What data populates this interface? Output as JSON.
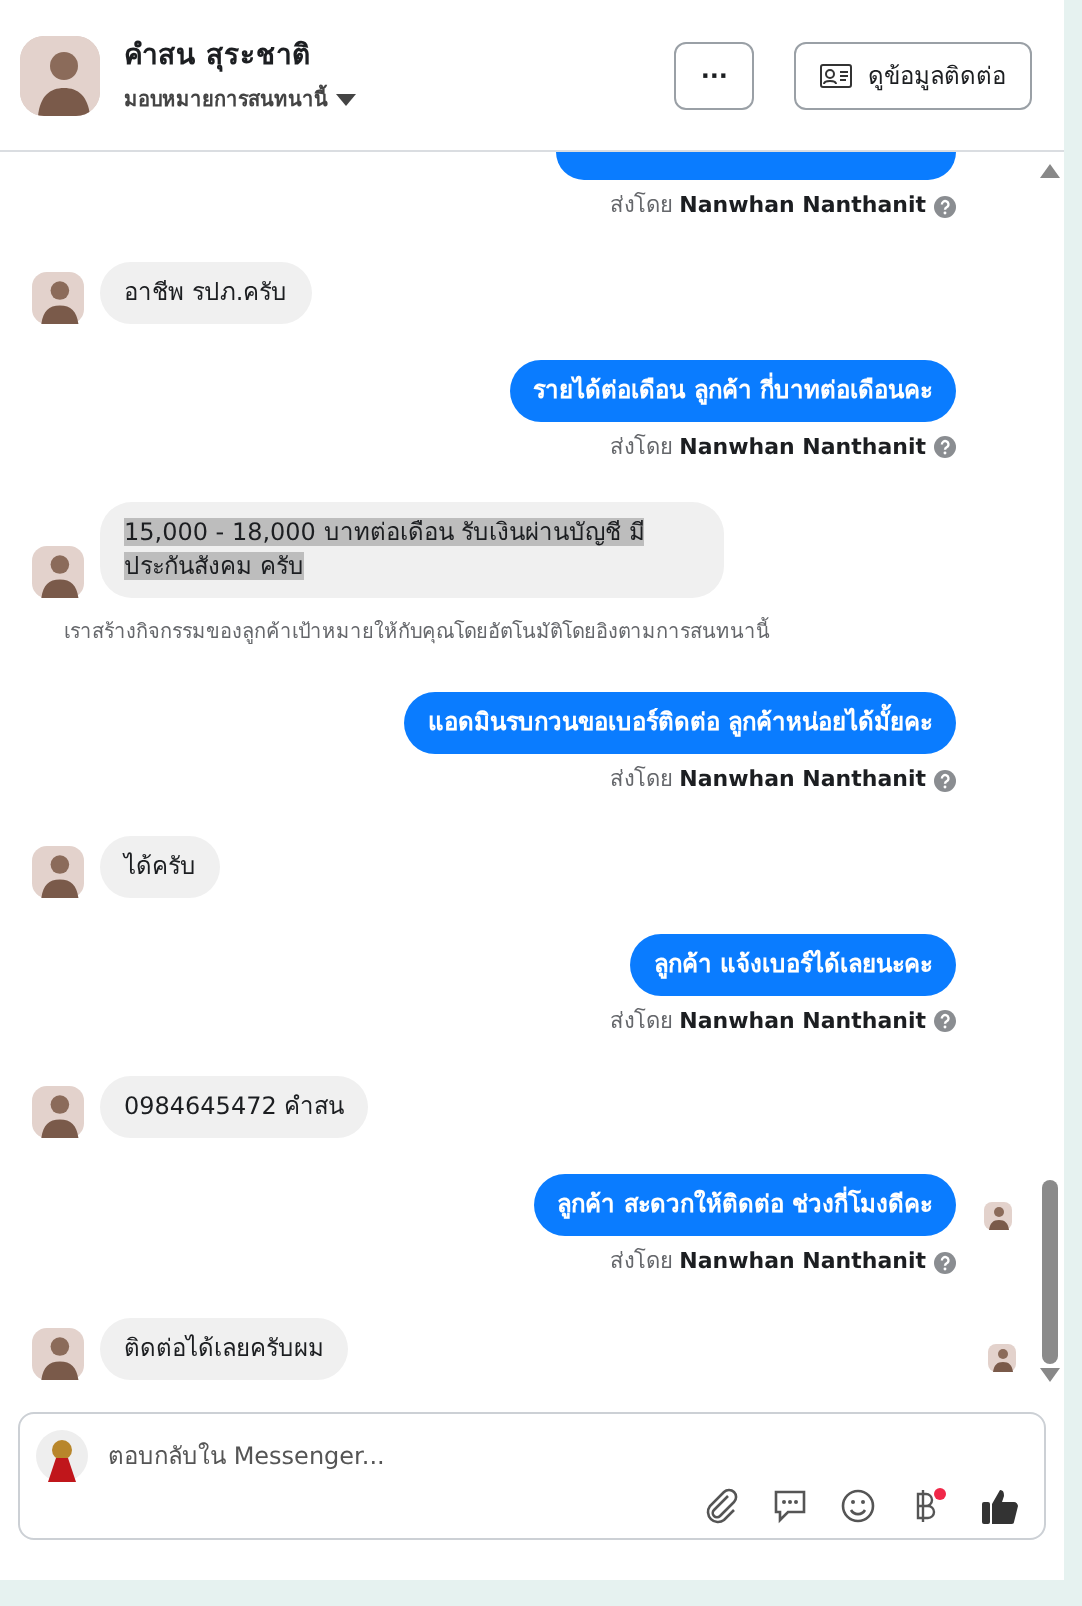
{
  "header": {
    "name": "คำสน สุระชาติ",
    "assign": "มอบหมายการสนทนานี้",
    "more": "···",
    "contact_button": "ดูข้อมูลติดต่อ"
  },
  "messages": [
    {
      "kind": "cutoff"
    },
    {
      "kind": "sent_by",
      "prefix": "ส่งโดย",
      "sender": "Nanwhan Nanthanit"
    },
    {
      "kind": "incoming",
      "text": "อาชีพ รปภ.ครับ",
      "highlighted": false,
      "seen": false
    },
    {
      "kind": "outgoing",
      "text": "รายได้ต่อเดือน  ลูกค้า กี่บาทต่อเดือนคะ",
      "seen": false
    },
    {
      "kind": "sent_by",
      "prefix": "ส่งโดย",
      "sender": "Nanwhan Nanthanit"
    },
    {
      "kind": "incoming",
      "text": "15,000 - 18,000 บาทต่อเดือน รับเงินผ่านบัญชี มีประกันสังคม ครับ",
      "highlighted": true,
      "seen": false
    },
    {
      "kind": "notice",
      "text": "เราสร้างกิจกรรมของลูกค้าเป้าหมายให้กับคุณโดยอัตโนมัติโดยอิงตามการสนทนานี้"
    },
    {
      "kind": "outgoing",
      "text": "แอดมินรบกวนขอเบอร์ติดต่อ ลูกค้าหน่อยได้มั้ยคะ",
      "seen": false
    },
    {
      "kind": "sent_by",
      "prefix": "ส่งโดย",
      "sender": "Nanwhan Nanthanit"
    },
    {
      "kind": "incoming",
      "text": "ได้ครับ",
      "highlighted": false,
      "seen": false
    },
    {
      "kind": "outgoing",
      "text": "ลูกค้า แจ้งเบอร์ได้เลยนะคะ",
      "seen": false
    },
    {
      "kind": "sent_by",
      "prefix": "ส่งโดย",
      "sender": "Nanwhan Nanthanit"
    },
    {
      "kind": "incoming",
      "text": "0984645472 คำสน",
      "highlighted": false,
      "seen": false
    },
    {
      "kind": "outgoing",
      "text": "ลูกค้า สะดวกให้ติดต่อ ช่วงกี่โมงดีคะ",
      "seen": true
    },
    {
      "kind": "sent_by",
      "prefix": "ส่งโดย",
      "sender": "Nanwhan Nanthanit"
    },
    {
      "kind": "incoming",
      "text": "ติดต่อได้เลยครับผม",
      "highlighted": false,
      "seen": true
    }
  ],
  "composer": {
    "placeholder": "ตอบกลับใน Messenger...",
    "payment_notification": true
  }
}
